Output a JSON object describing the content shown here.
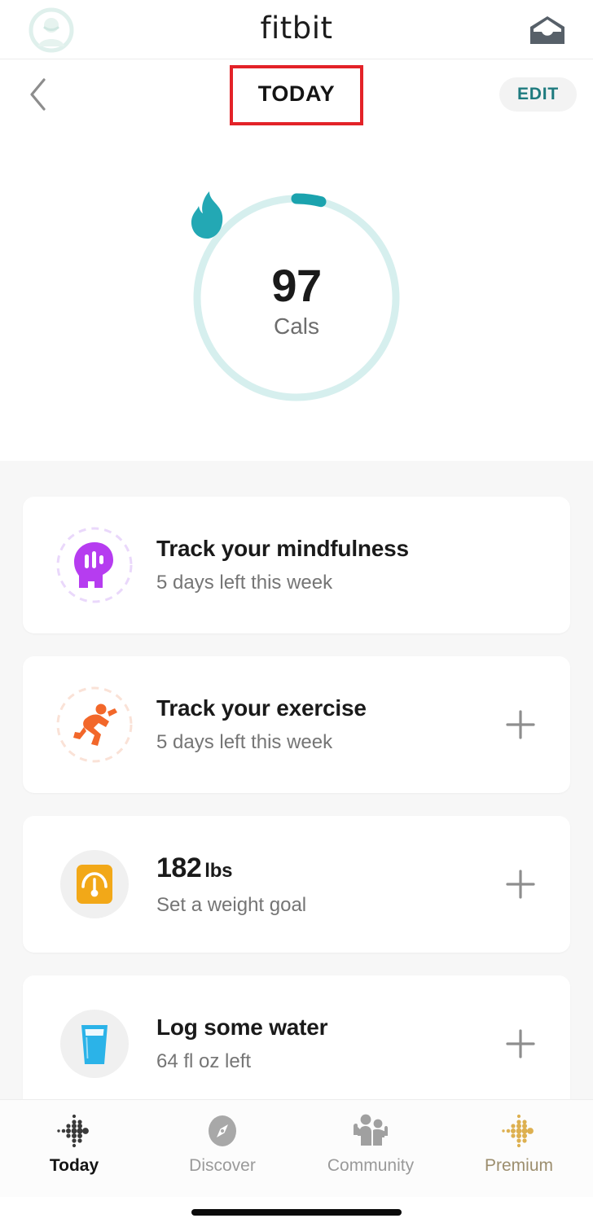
{
  "appbar": {
    "brand": "fitbit",
    "avatar_icon": "profile-avatar-icon",
    "inbox_icon": "inbox-envelope-icon"
  },
  "subheader": {
    "back_icon": "chevron-left-icon",
    "title": "TODAY",
    "edit_label": "EDIT",
    "annotation_color": "#e32228"
  },
  "hero": {
    "icon": "flame-icon",
    "value": "97",
    "unit": "Cals",
    "ring_track_color": "#d6efee",
    "ring_progress_color": "#1ba3ae",
    "ring_progress_percent": 4
  },
  "cards": [
    {
      "icon": "mindfulness-head-icon",
      "icon_color": "#b63cf0",
      "ring_color": "#ead8fb",
      "title": "Track your mindfulness",
      "subtitle": "5 days left this week",
      "has_add": false,
      "add_label": "+"
    },
    {
      "icon": "running-person-icon",
      "icon_color": "#f2672a",
      "ring_color": "#fae2d7",
      "title": "Track your exercise",
      "subtitle": "5 days left this week",
      "has_add": true,
      "add_label": "+"
    },
    {
      "icon": "weight-scale-icon",
      "icon_color": "#f2a818",
      "ring_color": "#efefef",
      "value": "182",
      "unit": "lbs",
      "title": "182 lbs",
      "subtitle": "Set a weight goal",
      "has_add": true,
      "add_label": "+"
    },
    {
      "icon": "water-glass-icon",
      "icon_color": "#2bb3e8",
      "ring_color": "#efefef",
      "title": "Log some water",
      "subtitle": "64 fl oz left",
      "has_add": true,
      "add_label": "+"
    }
  ],
  "bottomnav": [
    {
      "label": "Today",
      "icon": "fitbit-dots-icon",
      "active": true,
      "color": "#3a3a3a"
    },
    {
      "label": "Discover",
      "icon": "compass-icon",
      "active": false,
      "color": "#a8a8a8"
    },
    {
      "label": "Community",
      "icon": "community-people-icon",
      "active": false,
      "color": "#a0a0a0"
    },
    {
      "label": "Premium",
      "icon": "premium-dots-icon",
      "active": false,
      "color": "#ddb050"
    }
  ]
}
